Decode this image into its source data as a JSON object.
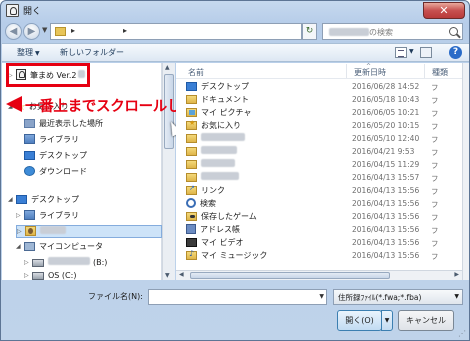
{
  "window": {
    "title": "開く",
    "close_glyph": "✕"
  },
  "nav": {
    "back_glyph": "◀",
    "forward_glyph": "▶",
    "history_glyph": "▼",
    "address_segments": [
      "▸",
      "",
      "▸",
      "",
      "▸"
    ],
    "refresh_glyph": "↻",
    "search_placeholder_suffix": "の検索"
  },
  "toolbar": {
    "organize_label": "整理",
    "new_folder_label": "新しいフォルダー"
  },
  "navigation_pane": {
    "items": [
      {
        "label": "筆まめ Ver.2",
        "icon": "fudemame-app-icon",
        "expander": "▷"
      },
      {
        "label": "お気に入り",
        "icon": "star-icon",
        "expander": "◢"
      },
      {
        "label": "最近表示した場所",
        "icon": "recent-places-icon",
        "expander": ""
      },
      {
        "label": "ライブラリ",
        "icon": "library-icon",
        "expander": ""
      },
      {
        "label": "デスクトップ",
        "icon": "desktop-icon",
        "expander": ""
      },
      {
        "label": "ダウンロード",
        "icon": "download-icon",
        "expander": ""
      },
      {
        "label": "デスクトップ",
        "icon": "desktop-icon",
        "expander": "◢"
      },
      {
        "label": "ライブラリ",
        "icon": "library-icon",
        "expander": "▷"
      },
      {
        "label": "",
        "icon": "user-folder-icon",
        "expander": "▷"
      },
      {
        "label": "マイコンピュータ",
        "icon": "computer-icon",
        "expander": "◢"
      },
      {
        "label": "(B:)",
        "icon": "drive-icon",
        "expander": "▷"
      },
      {
        "label": "OS (C:)",
        "icon": "drive-icon",
        "expander": "▷"
      }
    ]
  },
  "annotation": {
    "text": "一番上までスクロールし、「筆まめ」を選択します",
    "color": "#e60012"
  },
  "file_list": {
    "columns": [
      "名前",
      "更新日時",
      "種類"
    ],
    "rows": [
      {
        "name": "デスクトップ",
        "date": "2016/06/28 14:52",
        "type": "フ",
        "icon": "desktop-folder-icon"
      },
      {
        "name": "ドキュメント",
        "date": "2016/05/18 10:43",
        "type": "フ",
        "icon": "folder-icon"
      },
      {
        "name": "マイ ピクチャ",
        "date": "2016/06/05 10:21",
        "type": "フ",
        "icon": "pictures-folder-icon"
      },
      {
        "name": "お気に入り",
        "date": "2016/05/20 10:15",
        "type": "フ",
        "icon": "favorites-folder-icon"
      },
      {
        "name": "",
        "date": "2016/05/10 12:40",
        "type": "フ",
        "icon": "folder-icon"
      },
      {
        "name": "",
        "date": "2016/04/21 9:53",
        "type": "フ",
        "icon": "folder-icon"
      },
      {
        "name": "",
        "date": "2016/04/15 11:29",
        "type": "フ",
        "icon": "folder-icon"
      },
      {
        "name": "",
        "date": "2016/04/13 15:57",
        "type": "フ",
        "icon": "folder-icon"
      },
      {
        "name": "リンク",
        "date": "2016/04/13 15:56",
        "type": "フ",
        "icon": "links-folder-icon"
      },
      {
        "name": "検索",
        "date": "2016/04/13 15:56",
        "type": "フ",
        "icon": "search-folder-icon"
      },
      {
        "name": "保存したゲーム",
        "date": "2016/04/13 15:56",
        "type": "フ",
        "icon": "saved-games-folder-icon"
      },
      {
        "name": "アドレス帳",
        "date": "2016/04/13 15:56",
        "type": "フ",
        "icon": "contacts-folder-icon"
      },
      {
        "name": "マイ ビデオ",
        "date": "2016/04/13 15:56",
        "type": "フ",
        "icon": "videos-folder-icon"
      },
      {
        "name": "マイ ミュージック",
        "date": "2016/04/13 15:56",
        "type": "フ",
        "icon": "music-folder-icon"
      }
    ]
  },
  "bottom": {
    "filename_label": "ファイル名(N):",
    "filename_value": "",
    "filetype_value": "住所録ﾌｧｲﾙ(*.fwa;*.fba)",
    "open_label": "開く(O)",
    "cancel_label": "キャンセル"
  }
}
